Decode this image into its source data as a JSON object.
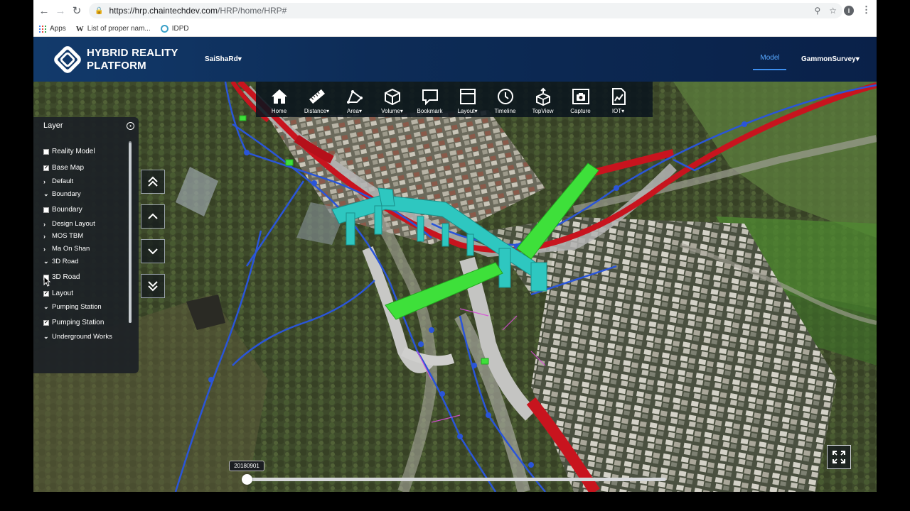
{
  "browser": {
    "url_host": "https://hrp.chaintechdev.com",
    "url_path": "/HRP/home/HRP#",
    "bookmarks": [
      "Apps",
      "List of proper nam...",
      "IDPD"
    ],
    "profile_initial": "i"
  },
  "header": {
    "brand_line1": "HYBRID REALITY",
    "brand_line2": "PLATFORM",
    "project": "SaiShaRd",
    "model_tab": "Model",
    "user": "GammonSurvey"
  },
  "toolbar": [
    {
      "label": "Home",
      "icon": "home-icon",
      "dropdown": false
    },
    {
      "label": "Distance",
      "icon": "ruler-icon",
      "dropdown": true
    },
    {
      "label": "Area",
      "icon": "area-icon",
      "dropdown": true
    },
    {
      "label": "Volume",
      "icon": "cube-icon",
      "dropdown": true
    },
    {
      "label": "Bookmark",
      "icon": "bookmark-icon",
      "dropdown": false
    },
    {
      "label": "Layout",
      "icon": "layout-icon",
      "dropdown": true
    },
    {
      "label": "Timeline",
      "icon": "clock-icon",
      "dropdown": false
    },
    {
      "label": "TopView",
      "icon": "topview-icon",
      "dropdown": false
    },
    {
      "label": "Capture",
      "icon": "camera-icon",
      "dropdown": false
    },
    {
      "label": "IOT",
      "icon": "iot-chart-icon",
      "dropdown": true
    }
  ],
  "layer_panel": {
    "title": "Layer",
    "items": [
      {
        "label": "Reality Model",
        "kind": "checkbox",
        "checked": false
      },
      {
        "label": "Base Map",
        "kind": "checkbox",
        "checked": true
      },
      {
        "label": "Default",
        "kind": "group",
        "expanded": false
      },
      {
        "label": "Boundary",
        "kind": "group",
        "expanded": true
      },
      {
        "label": "Boundary",
        "kind": "checkbox",
        "checked": false
      },
      {
        "label": "Design Layout",
        "kind": "group",
        "expanded": false
      },
      {
        "label": "MOS TBM",
        "kind": "group",
        "expanded": false
      },
      {
        "label": "Ma On Shan",
        "kind": "group",
        "expanded": false
      },
      {
        "label": "3D Road",
        "kind": "group",
        "expanded": true
      },
      {
        "label": "3D Road",
        "kind": "checkbox",
        "checked": false
      },
      {
        "label": "Layout",
        "kind": "checkbox",
        "checked": true
      },
      {
        "label": "Pumping Station",
        "kind": "group",
        "expanded": true
      },
      {
        "label": "Pumping Station",
        "kind": "checkbox",
        "checked": true
      },
      {
        "label": "Underground Works",
        "kind": "group",
        "expanded": true
      }
    ]
  },
  "camera_controls": [
    "double-chevron-up-icon",
    "chevron-up-icon",
    "chevron-down-icon",
    "double-chevron-down-icon"
  ],
  "timeline": {
    "date_label": "20180901",
    "position": 0
  },
  "colors": {
    "header_bg": "#0d2c57",
    "accent_blue": "#3d8ff0",
    "pipe_red": "#c8141e",
    "pipe_blue": "#2a55d8",
    "structure_teal": "#2ec7c0",
    "structure_green": "#3ee03a"
  }
}
